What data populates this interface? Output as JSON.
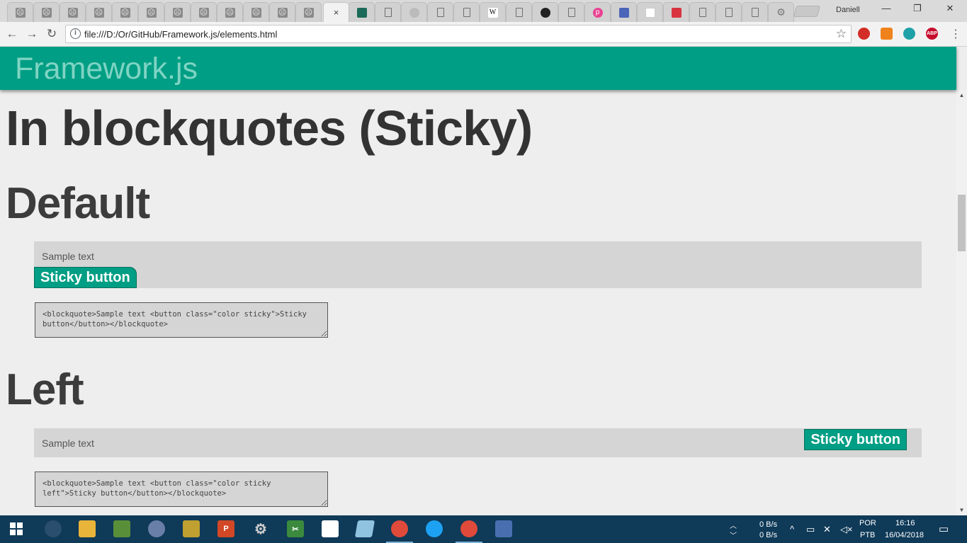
{
  "browser": {
    "profile_name": "Daniell",
    "active_tab_close": "×",
    "url": "file:///D:/Or/GitHub/Framework.js/elements.html",
    "window_controls": {
      "minimize": "—",
      "restore": "❐",
      "close": "✕"
    },
    "extensions": [
      {
        "name": "lastpass-icon",
        "color": "#d32d27",
        "glyph": ""
      },
      {
        "name": "metamask-icon",
        "color": "#f0821b",
        "glyph": ""
      },
      {
        "name": "sync-icon",
        "color": "#1fa1a8",
        "glyph": ""
      },
      {
        "name": "adblock-plus-icon",
        "color": "#c70d2c",
        "glyph": "ABP"
      }
    ]
  },
  "app": {
    "brand": "Framework.js"
  },
  "page": {
    "section_title": "In blockquotes (Sticky)",
    "default": {
      "heading": "Default",
      "sample_text": "Sample text",
      "button_label": "Sticky button",
      "code": "<blockquote>Sample text <button class=\"color sticky\">Sticky button</button></blockquote>"
    },
    "left": {
      "heading": "Left",
      "sample_text": "Sample text",
      "button_label": "Sticky button",
      "code": "<blockquote>Sample text <button class=\"color sticky left\">Sticky button</button></blockquote>"
    }
  },
  "taskbar": {
    "net_up": "0 B/s",
    "net_down": "0 B/s",
    "lang_top": "POR",
    "lang_bottom": "PTB",
    "time": "16:16",
    "date": "16/04/2018"
  },
  "colors": {
    "accent": "#009e84",
    "accent_light": "#7fd4c4",
    "blockquote_bg": "#d5d5d5",
    "taskbar_bg": "#0f3a58"
  }
}
